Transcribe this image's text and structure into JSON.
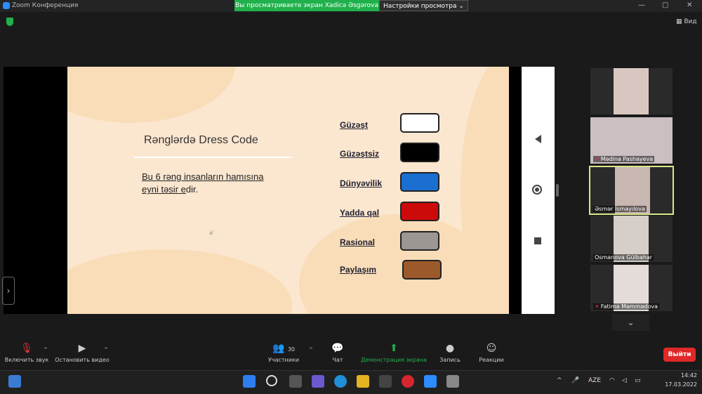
{
  "window": {
    "title": "Zoom Конференция",
    "share_banner": "Вы просматриваете экран Xadicə Əsgərova",
    "view_settings": "Настройки просмотра ⌄",
    "view_label": "Вид"
  },
  "slide": {
    "title": "Rənglərdə Dress Code",
    "subtitle_underlined": "Bu 6 rəng insanların hamısına eyni təsir e",
    "subtitle_rest": "dir.",
    "rows": [
      {
        "label": "Güzəşt",
        "color": "#ffffff"
      },
      {
        "label": "Güzəştsiz",
        "color": "#000000"
      },
      {
        "label": "Dünyəvilik",
        "color": "#1a6fd1"
      },
      {
        "label": "Yadda qal",
        "color": "#cc0a0a"
      },
      {
        "label": "Rasional",
        "color": "#9c9793"
      },
      {
        "label": "Paylaşım",
        "color": "#9c5a2a"
      }
    ]
  },
  "participants": [
    {
      "name": ""
    },
    {
      "name": "Mədina Pashayeva"
    },
    {
      "name": "Əsmər İsmayılova"
    },
    {
      "name": "Osmanova Gülbahar"
    },
    {
      "name": "Fatimə Məmmədova"
    }
  ],
  "toolbar": {
    "audio_label": "Включить звук",
    "video_label": "Остановить видео",
    "participants_label": "Участники",
    "participants_count": "30",
    "chat_label": "Чат",
    "share_label": "Демонстрация экрана",
    "record_label": "Запись",
    "reactions_label": "Реакции",
    "leave_label": "Выйти"
  },
  "taskbar": {
    "language": "AZE",
    "time": "14:42",
    "date": "17.03.2022"
  }
}
